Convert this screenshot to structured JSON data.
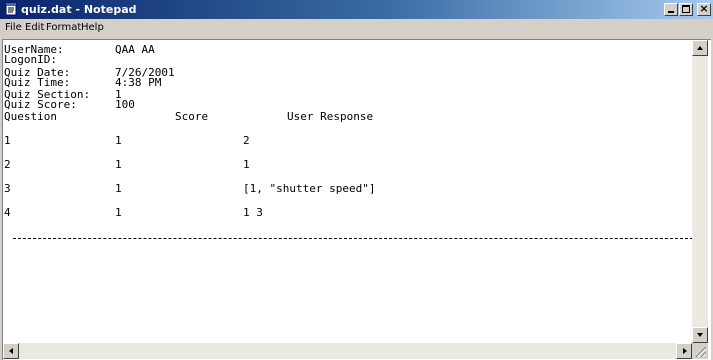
{
  "window": {
    "title": "quiz.dat - Notepad",
    "icon": "notepad-icon",
    "controls": {
      "minimize_icon": "minimize-icon",
      "maximize_icon": "maximize-icon",
      "close_icon": "close-icon",
      "close_glyph": "×"
    }
  },
  "menu": {
    "file": "File",
    "edit": "Edit",
    "format": "Format",
    "help": "Help"
  },
  "document": {
    "header": [
      {
        "label": "UserName:",
        "value": "QAA AA"
      },
      {
        "label": "LogonID:",
        "value": ""
      },
      {
        "label": "Quiz Date:",
        "value": "7/26/2001"
      },
      {
        "label": "Quiz Time:",
        "value": "4:38 PM"
      },
      {
        "label": "Quiz Section:",
        "value": "1"
      },
      {
        "label": "Quiz Score:",
        "value": "100"
      }
    ],
    "columns": {
      "question": "Question",
      "score": "Score",
      "response": "User Response"
    },
    "rows": [
      {
        "question": "1",
        "score": "1",
        "response": "2"
      },
      {
        "question": "2",
        "score": "1",
        "response": "1"
      },
      {
        "question": "3",
        "score": "1",
        "response": "[1, \"shutter speed\"]"
      },
      {
        "question": "4",
        "score": "1",
        "response": "1 3"
      }
    ]
  },
  "colors": {
    "title_start": "#0a246a",
    "title_end": "#a6caf0",
    "chrome": "#d4d0c8",
    "editor_bg": "#ffffff"
  }
}
